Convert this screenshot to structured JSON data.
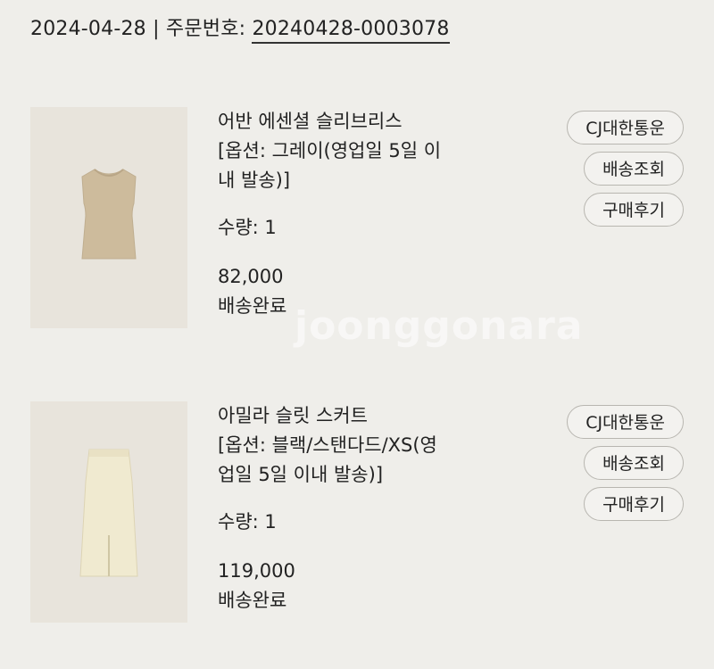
{
  "order": {
    "date": "2024-04-28",
    "separator": "|",
    "order_label": "주문번호:",
    "order_number": "20240428-0003078"
  },
  "items": [
    {
      "name": "어반 에센셜 슬리브리스",
      "option_line1": "[옵션: 그레이(영업일 5일 이",
      "option_line2": "내 발송)]",
      "quantity": "수량: 1",
      "price": "82,000",
      "status": "배송완료",
      "buttons": [
        "CJ대한통운",
        "배송조회",
        "구매후기"
      ],
      "image_icon": "sleeveless-knit-top-photo"
    },
    {
      "name": "아밀라 슬릿 스커트",
      "option_line1": "[옵션: 블랙/스탠다드/XS(영",
      "option_line2": "업일 5일 이내 발송)]",
      "quantity": "수량: 1",
      "price": "119,000",
      "status": "배송완료",
      "buttons": [
        "CJ대한통운",
        "배송조회",
        "구매후기"
      ],
      "image_icon": "slit-skirt-photo"
    }
  ],
  "watermark": "joonggonara"
}
